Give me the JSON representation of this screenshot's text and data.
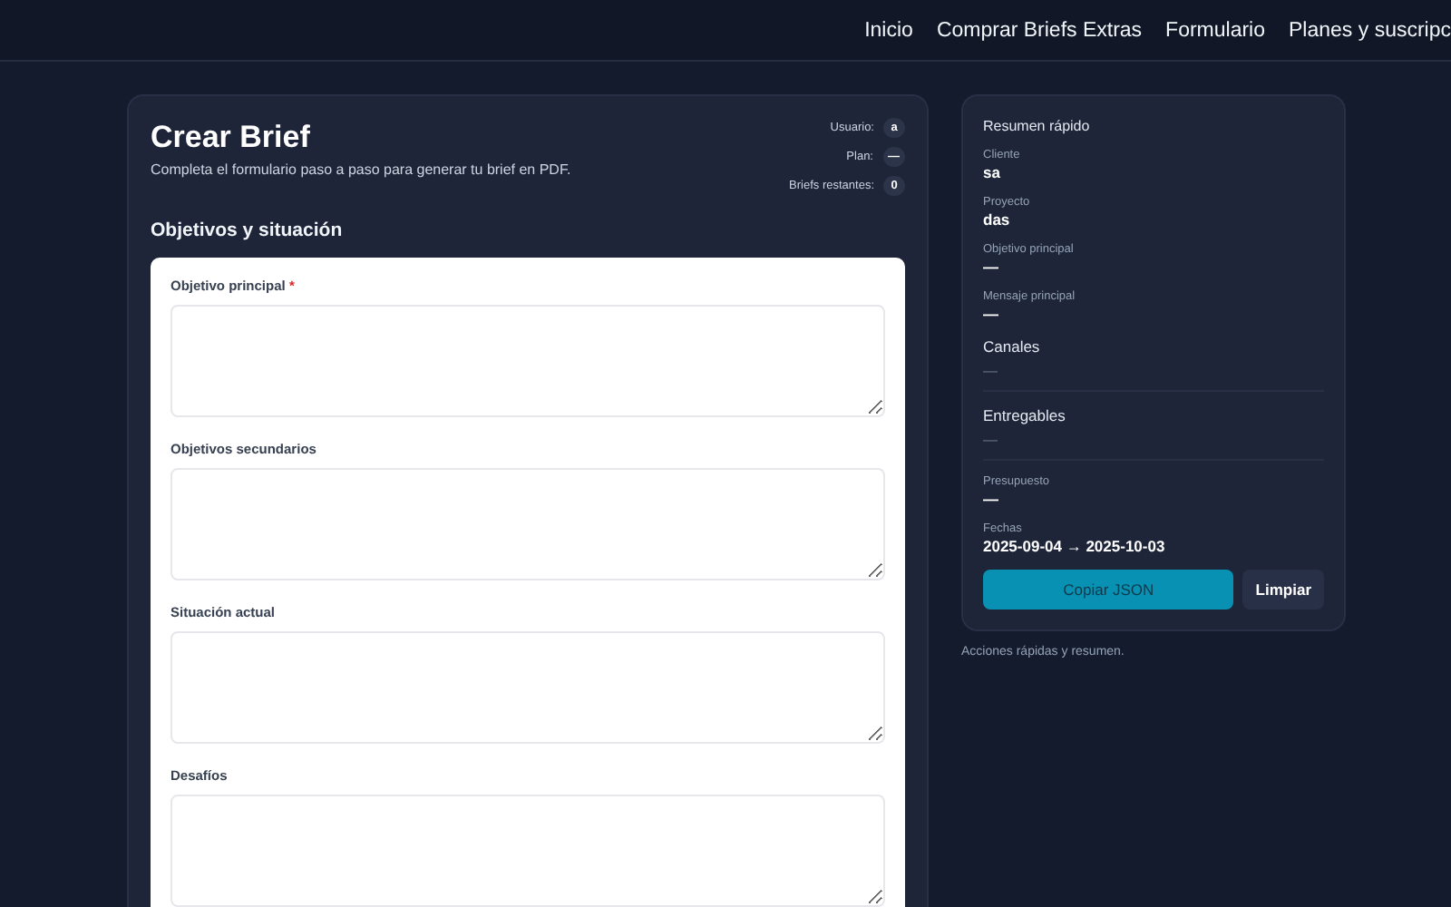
{
  "nav": {
    "links": [
      {
        "label": "Inicio"
      },
      {
        "label": "Comprar Briefs Extras"
      },
      {
        "label": "Formulario"
      },
      {
        "label": "Planes y suscripc"
      }
    ]
  },
  "form_card": {
    "title": "Crear Brief",
    "subtitle": "Completa el formulario paso a paso para generar tu brief en PDF.",
    "stats": [
      {
        "label": "Usuario:",
        "value": "a"
      },
      {
        "label": "Plan:",
        "value": "—"
      },
      {
        "label": "Briefs restantes:",
        "value": "0"
      }
    ],
    "section_title": "Objetivos y situación",
    "fields": [
      {
        "label": "Objetivo principal",
        "required_mark": "*"
      },
      {
        "label": "Objetivos secundarios"
      },
      {
        "label": "Situación actual"
      },
      {
        "label": "Desafíos"
      }
    ]
  },
  "summary": {
    "title": "Resumen rápido",
    "items": [
      {
        "kind": "field",
        "label": "Cliente",
        "value": "sa"
      },
      {
        "kind": "field",
        "label": "Proyecto",
        "value": "das"
      },
      {
        "kind": "field",
        "label": "Objetivo principal",
        "value": "—"
      },
      {
        "kind": "field",
        "label": "Mensaje principal",
        "value": "—"
      },
      {
        "kind": "section",
        "label": "Canales",
        "value": "—"
      },
      {
        "kind": "section",
        "label": "Entregables",
        "value": "—"
      },
      {
        "kind": "field",
        "label": "Presupuesto",
        "value": "—"
      },
      {
        "kind": "field",
        "label": "Fechas",
        "value": "2025-09-04 → 2025-10-03"
      }
    ],
    "buttons": [
      {
        "label": "Copiar JSON",
        "kind": "primary"
      },
      {
        "label": "Limpiar",
        "kind": "secondary"
      }
    ],
    "note": "Acciones rápidas y resumen."
  }
}
